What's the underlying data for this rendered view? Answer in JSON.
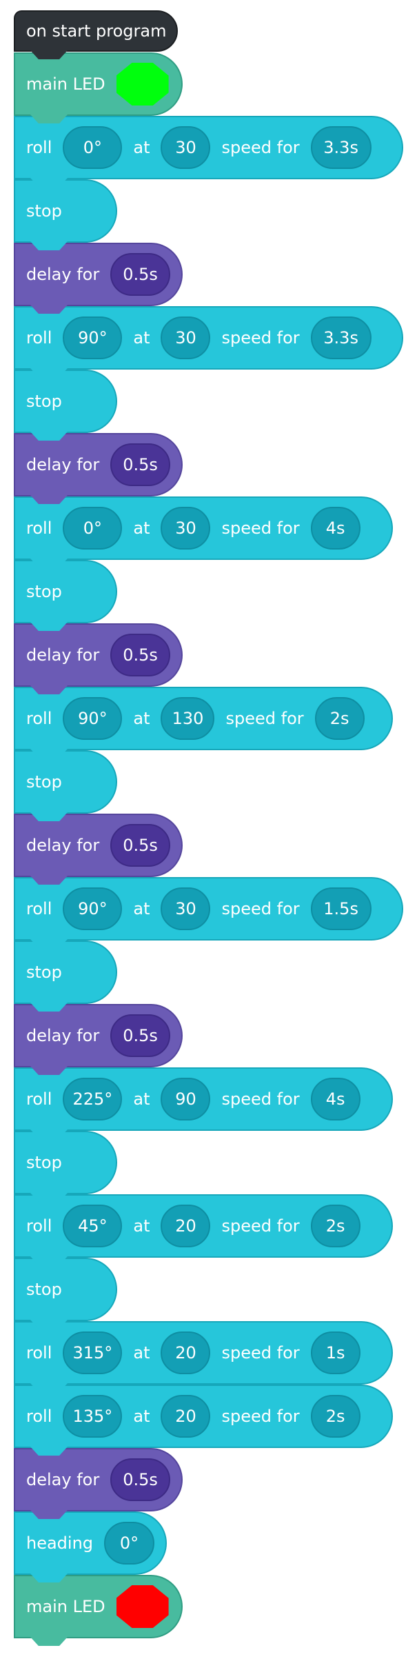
{
  "colors": {
    "hat": "#2e3338",
    "led_block": "#48bb9f",
    "motion_block": "#26c6da",
    "motion_pill": "#139fb5",
    "delay_block": "#6b5bb5",
    "delay_pill": "#4a3497",
    "led_green": "#00ff0d",
    "led_red": "#ff0000"
  },
  "icons": {
    "color_swatch": "octagon-swatch"
  },
  "blocks": [
    {
      "kind": "hat",
      "label": "on start program"
    },
    {
      "kind": "led",
      "label": "main LED",
      "color": "#00ff0d"
    },
    {
      "kind": "roll",
      "label": "roll",
      "heading": "0°",
      "at": "at",
      "speed": "30",
      "speed_for": "speed for",
      "duration": "3.3s"
    },
    {
      "kind": "stop",
      "label": "stop"
    },
    {
      "kind": "delay",
      "label": "delay for",
      "duration": "0.5s"
    },
    {
      "kind": "roll",
      "label": "roll",
      "heading": "90°",
      "at": "at",
      "speed": "30",
      "speed_for": "speed for",
      "duration": "3.3s"
    },
    {
      "kind": "stop",
      "label": "stop"
    },
    {
      "kind": "delay",
      "label": "delay for",
      "duration": "0.5s"
    },
    {
      "kind": "roll",
      "label": "roll",
      "heading": "0°",
      "at": "at",
      "speed": "30",
      "speed_for": "speed for",
      "duration": "4s"
    },
    {
      "kind": "stop",
      "label": "stop"
    },
    {
      "kind": "delay",
      "label": "delay for",
      "duration": "0.5s"
    },
    {
      "kind": "roll",
      "label": "roll",
      "heading": "90°",
      "at": "at",
      "speed": "130",
      "speed_for": "speed for",
      "duration": "2s"
    },
    {
      "kind": "stop",
      "label": "stop"
    },
    {
      "kind": "delay",
      "label": "delay for",
      "duration": "0.5s"
    },
    {
      "kind": "roll",
      "label": "roll",
      "heading": "90°",
      "at": "at",
      "speed": "30",
      "speed_for": "speed for",
      "duration": "1.5s"
    },
    {
      "kind": "stop",
      "label": "stop"
    },
    {
      "kind": "delay",
      "label": "delay for",
      "duration": "0.5s"
    },
    {
      "kind": "roll",
      "label": "roll",
      "heading": "225°",
      "at": "at",
      "speed": "90",
      "speed_for": "speed for",
      "duration": "4s"
    },
    {
      "kind": "stop",
      "label": "stop"
    },
    {
      "kind": "roll",
      "label": "roll",
      "heading": "45°",
      "at": "at",
      "speed": "20",
      "speed_for": "speed for",
      "duration": "2s"
    },
    {
      "kind": "stop",
      "label": "stop"
    },
    {
      "kind": "roll",
      "label": "roll",
      "heading": "315°",
      "at": "at",
      "speed": "20",
      "speed_for": "speed for",
      "duration": "1s"
    },
    {
      "kind": "roll",
      "label": "roll",
      "heading": "135°",
      "at": "at",
      "speed": "20",
      "speed_for": "speed for",
      "duration": "2s"
    },
    {
      "kind": "delay",
      "label": "delay for",
      "duration": "0.5s"
    },
    {
      "kind": "heading",
      "label": "heading",
      "heading": "0°"
    },
    {
      "kind": "led",
      "label": "main LED",
      "color": "#ff0000"
    }
  ]
}
